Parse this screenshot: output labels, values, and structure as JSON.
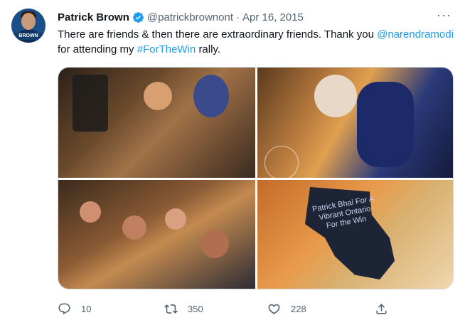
{
  "author": {
    "name": "Patrick Brown",
    "handle": "@patrickbrownont",
    "date": "Apr 16, 2015",
    "avatar_banner": "BROWN"
  },
  "tweet": {
    "text_prefix": "There are friends & then there are extraordinary friends. Thank you",
    "mention": "@narendramodi",
    "text_mid": "for attending my",
    "hashtag": "#ForTheWin",
    "text_suffix": "rally."
  },
  "media": {
    "badge_text": "Patrick Bhai For A Vibrant Ontario For the Win"
  },
  "actions": {
    "replies": "10",
    "retweets": "350",
    "likes": "228"
  },
  "colors": {
    "link": "#1d9bf0",
    "muted": "#536471",
    "verified": "#1d9bf0"
  }
}
